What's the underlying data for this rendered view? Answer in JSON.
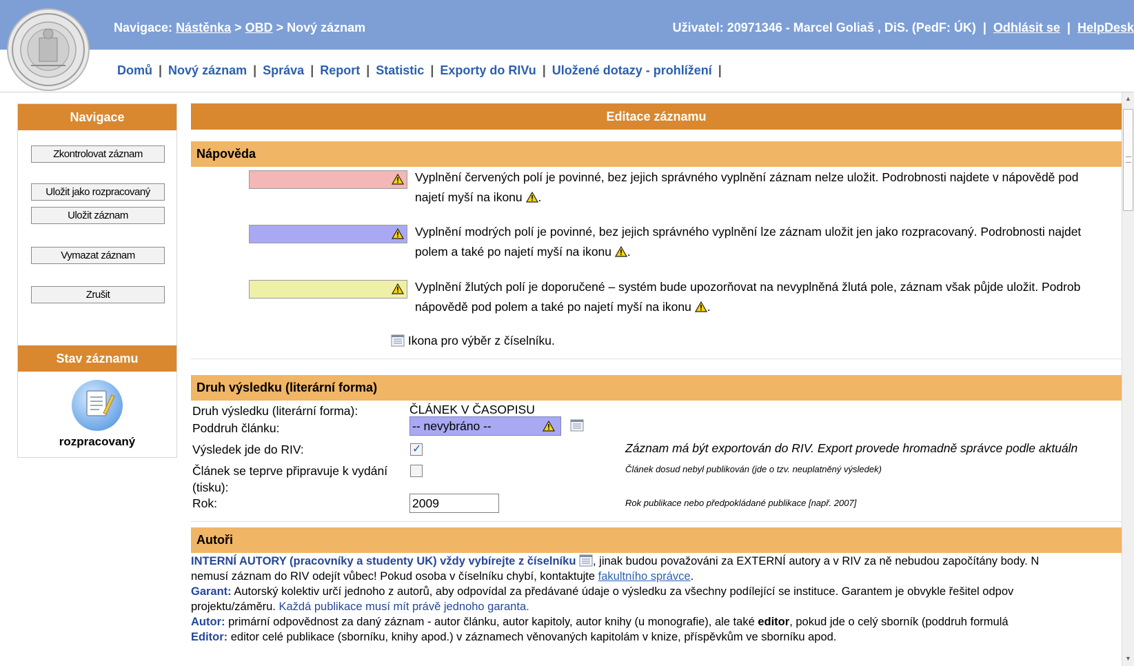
{
  "header": {
    "nav_label": "Navigace:",
    "crumb_home": "Nástěnka",
    "crumb_sep1": " > ",
    "crumb_obd": "OBD",
    "crumb_current": " > Nový záznam",
    "user_text": "Uživatel: 20971346 - Marcel Goliaš , DiS. (PedF: ÚK)",
    "user_sep1": "  |  ",
    "logout": "Odhlásit se",
    "user_sep2": "  |  ",
    "helpdesk": "HelpDesk"
  },
  "menu": {
    "items": [
      "Domů",
      "Nový záznam",
      "Správa",
      "Report",
      "Statistic",
      "Exporty do RIVu",
      "Uložené dotazy - prohlížení"
    ],
    "separator": "|"
  },
  "sidebar": {
    "nav_title": "Navigace",
    "buttons": [
      "Zkontrolovat záznam",
      "Uložit jako rozpracovaný",
      "Uložit záznam",
      "Vymazat záznam",
      "Zrušit"
    ],
    "status_title": "Stav záznamu",
    "status_value": "rozpracovaný"
  },
  "main": {
    "title": "Editace záznamu",
    "help": {
      "title": "Nápověda",
      "red_line1": "Vyplnění červených polí je povinné, bez jejich správného vyplnění záznam nelze uložit. Podrobnosti najdete v nápovědě pod",
      "red_line2": "najetí myší na ikonu",
      "blue_line1": "Vyplnění modrých polí je povinné, bez jejich správného vyplnění lze záznam uložit jen jako rozpracovaný. Podrobnosti najdet",
      "blue_line2": "polem a také po najetí myší na ikonu",
      "yellow_line1": "Vyplnění žlutých polí je doporučené – systém bude upozorňovat na nevyplněná žlutá pole, záznam však půjde uložit. Podrob",
      "yellow_line2": "nápovědě pod polem a také po najetí myší na ikonu",
      "dot": ".",
      "codelist_text": "Ikona pro výběr z číselníku.",
      "red_color": "#f4b6b6",
      "blue_color": "#a9a9f3",
      "yellow_color": "#eef0a8"
    },
    "result": {
      "title": "Druh výsledku (literární forma)",
      "type_label": "Druh výsledku (literární forma):",
      "type_value": "ČLÁNEK V ČASOPISU",
      "subtype_label": "Poddruh článku:",
      "subtype_value": "-- nevybráno --",
      "riv_label": "Výsledek jde do RIV:",
      "riv_checked": true,
      "riv_hint": "Záznam má být exportován do RIV. Export provede hromadně správce podle aktuáln",
      "prep_label_1": "Článek se teprve připravuje k vydání",
      "prep_label_2": "(tisku):",
      "prep_checked": false,
      "prep_hint": "Článek dosud nebyl publikován (jde o tzv. neuplatněný výsledek)",
      "year_label": "Rok:",
      "year_value": "2009",
      "year_hint": "Rok publikace nebo předpokládané publikace [např. 2007]"
    },
    "authors": {
      "title": "Autoři",
      "line1_bold": "INTERNÍ AUTORY (pracovníky a studenty UK) vždy vybírejte z číselníku",
      "line1_rest": ", jinak budou považováni za EXTERNÍ autory a v RIV za ně nebudou započítány body. N",
      "line2_start": "nemusí záznam do RIV odejít vůbec! Pokud osoba v číselníku chybí, kontaktujte ",
      "line2_link": "fakultního správce",
      "line2_end": ".",
      "garant_label": "Garant:",
      "garant_text": " Autorský kolektiv určí jednoho z autorů, aby odpovídal za předávané údaje o výsledku za všechny podílející se instituce. Garantem je obvykle řešitel odpov",
      "garant_line2_start": "projektu/záměru. ",
      "garant_line2_blue": "Každá publikace musí mít právě jednoho garanta.",
      "autor_label": "Autor:",
      "autor_text_1": " primární odpovědnost za daný záznam - autor článku, autor kapitoly, autor knihy (u monografie), ale také ",
      "autor_bold": "editor",
      "autor_text_2": ", pokud jde o celý sborník (poddruh formulá",
      "editor_label": "Editor:",
      "editor_text": " editor celé publikace (sborníku, knihy apod.) v záznamech věnovaných kapitolám v knize, příspěvkům ve sborníku apod."
    }
  }
}
